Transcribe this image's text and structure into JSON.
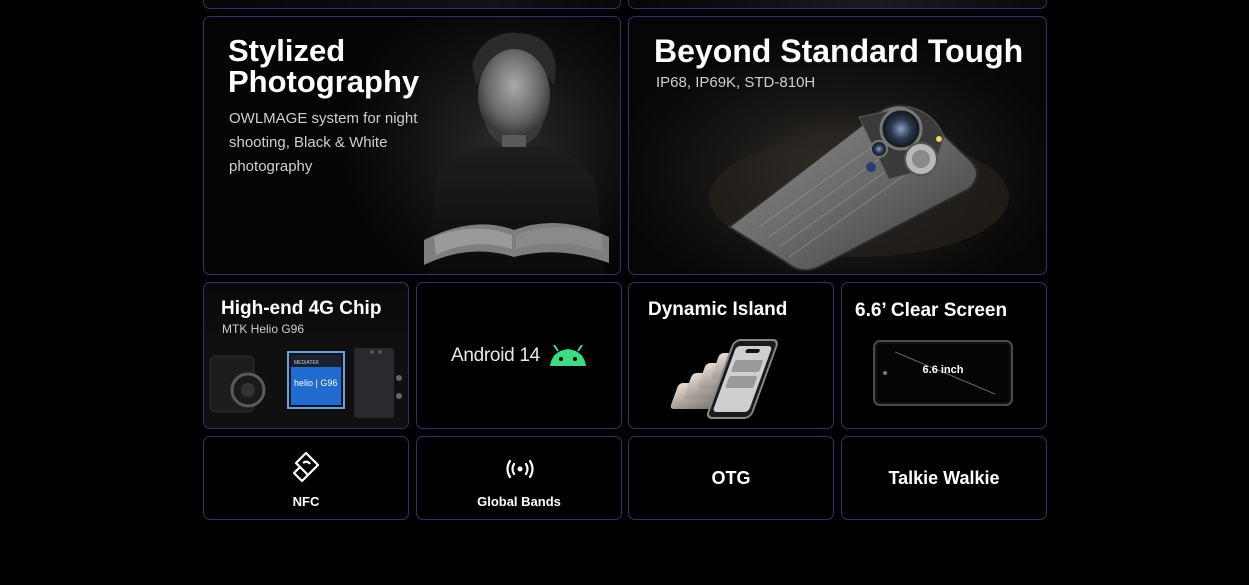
{
  "features": {
    "photography": {
      "title": "Stylized\nPhotography",
      "description": "OWLMAGE system for night shooting, Black & White photography"
    },
    "tough": {
      "title": "Beyond Standard Tough",
      "subtitle": "IP68, IP69K, STD-810H"
    },
    "chip": {
      "title": "High-end 4G Chip",
      "subtitle": "MTK Helio G96",
      "chip_brand": "MEDIATEK",
      "chip_label": "helio | G96"
    },
    "android": {
      "label": "Android 14",
      "icon": "android-logo-icon",
      "logo_color": "#3ddc84"
    },
    "island": {
      "title": "Dynamic Island"
    },
    "screen": {
      "title": "6.6’ Clear Screen",
      "screen_label": "6.6 inch"
    },
    "nfc": {
      "label": "NFC",
      "icon": "nfc-icon"
    },
    "bands": {
      "label": "Global Bands",
      "icon": "signal-broadcast-icon"
    },
    "otg": {
      "label": "OTG"
    },
    "walkie": {
      "label": "Talkie Walkie"
    }
  },
  "colors": {
    "background": "#000000",
    "card_border": "#34306a",
    "accent_green": "#3ddc84"
  }
}
